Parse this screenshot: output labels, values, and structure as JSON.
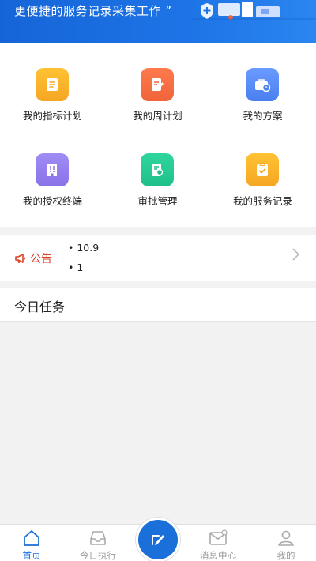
{
  "banner": {
    "text": "更便捷的服务记录采集工作 ”"
  },
  "menu": [
    {
      "label": "我的指标计划",
      "icon": "document-icon",
      "color": "#f5a623"
    },
    {
      "label": "我的周计划",
      "icon": "edit-note-icon",
      "color": "#f0643a"
    },
    {
      "label": "我的方案",
      "icon": "briefcase-clock-icon",
      "color": "#4a7ff0"
    },
    {
      "label": "我的授权终端",
      "icon": "building-icon",
      "color": "#8a72e8"
    },
    {
      "label": "审批管理",
      "icon": "approval-doc-icon",
      "color": "#1fc08a"
    },
    {
      "label": "我的服务记录",
      "icon": "clipboard-check-icon",
      "color": "#f5a623"
    }
  ],
  "notice": {
    "label": "公告",
    "items": [
      "• 10.9",
      "• 1"
    ],
    "color": "#d9442b"
  },
  "tasks": {
    "title": "今日任务"
  },
  "tabs": [
    {
      "label": "首页",
      "icon": "home-icon",
      "active": true
    },
    {
      "label": "今日执行",
      "icon": "inbox-icon",
      "active": false
    },
    {
      "label": "",
      "icon": "compose-icon",
      "active": false
    },
    {
      "label": "消息中心",
      "icon": "mail-icon",
      "active": false
    },
    {
      "label": "我的",
      "icon": "user-icon",
      "active": false
    }
  ],
  "accent": "#1a6fd8"
}
